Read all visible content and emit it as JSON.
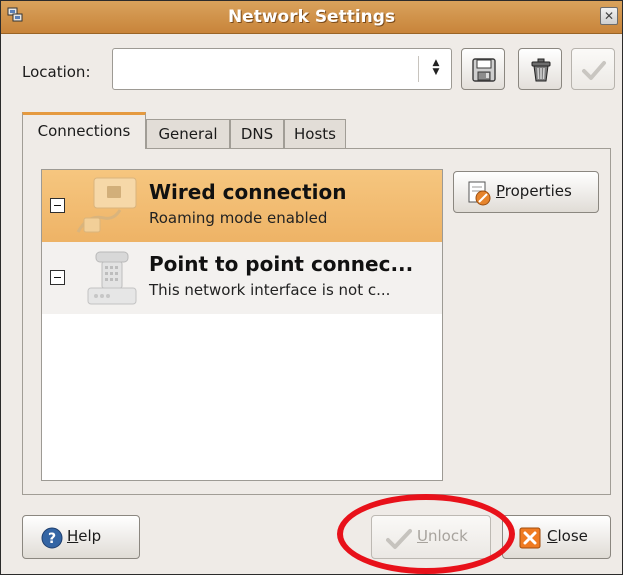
{
  "window": {
    "title": "Network Settings"
  },
  "location": {
    "label": "Location:",
    "value": ""
  },
  "toolbar": {
    "save_icon": "floppy-disk-icon",
    "delete_icon": "trash-can-icon",
    "apply_icon": "checkmark-icon"
  },
  "tabs": [
    {
      "label": "Connections",
      "active": true
    },
    {
      "label": "General",
      "active": false
    },
    {
      "label": "DNS",
      "active": false
    },
    {
      "label": "Hosts",
      "active": false
    }
  ],
  "connections": [
    {
      "name": "Wired connection",
      "status": "Roaming mode enabled",
      "icon": "wired-network-icon",
      "selected": true
    },
    {
      "name": "Point to point connec...",
      "status": "This network interface is not c...",
      "icon": "modem-phone-icon",
      "selected": false
    }
  ],
  "buttons": {
    "properties": {
      "prefix": "",
      "mnemonic": "P",
      "rest": "roperties"
    },
    "help": {
      "prefix": "",
      "mnemonic": "H",
      "rest": "elp"
    },
    "unlock": {
      "prefix": "",
      "mnemonic": "U",
      "rest": "nlock"
    },
    "close": {
      "prefix": "",
      "mnemonic": "C",
      "rest": "lose"
    }
  },
  "colors": {
    "titlebar": "#c8843a",
    "selection": "#f0b86c",
    "tab_accent": "#e59a40",
    "annotation": "#e8111a"
  }
}
